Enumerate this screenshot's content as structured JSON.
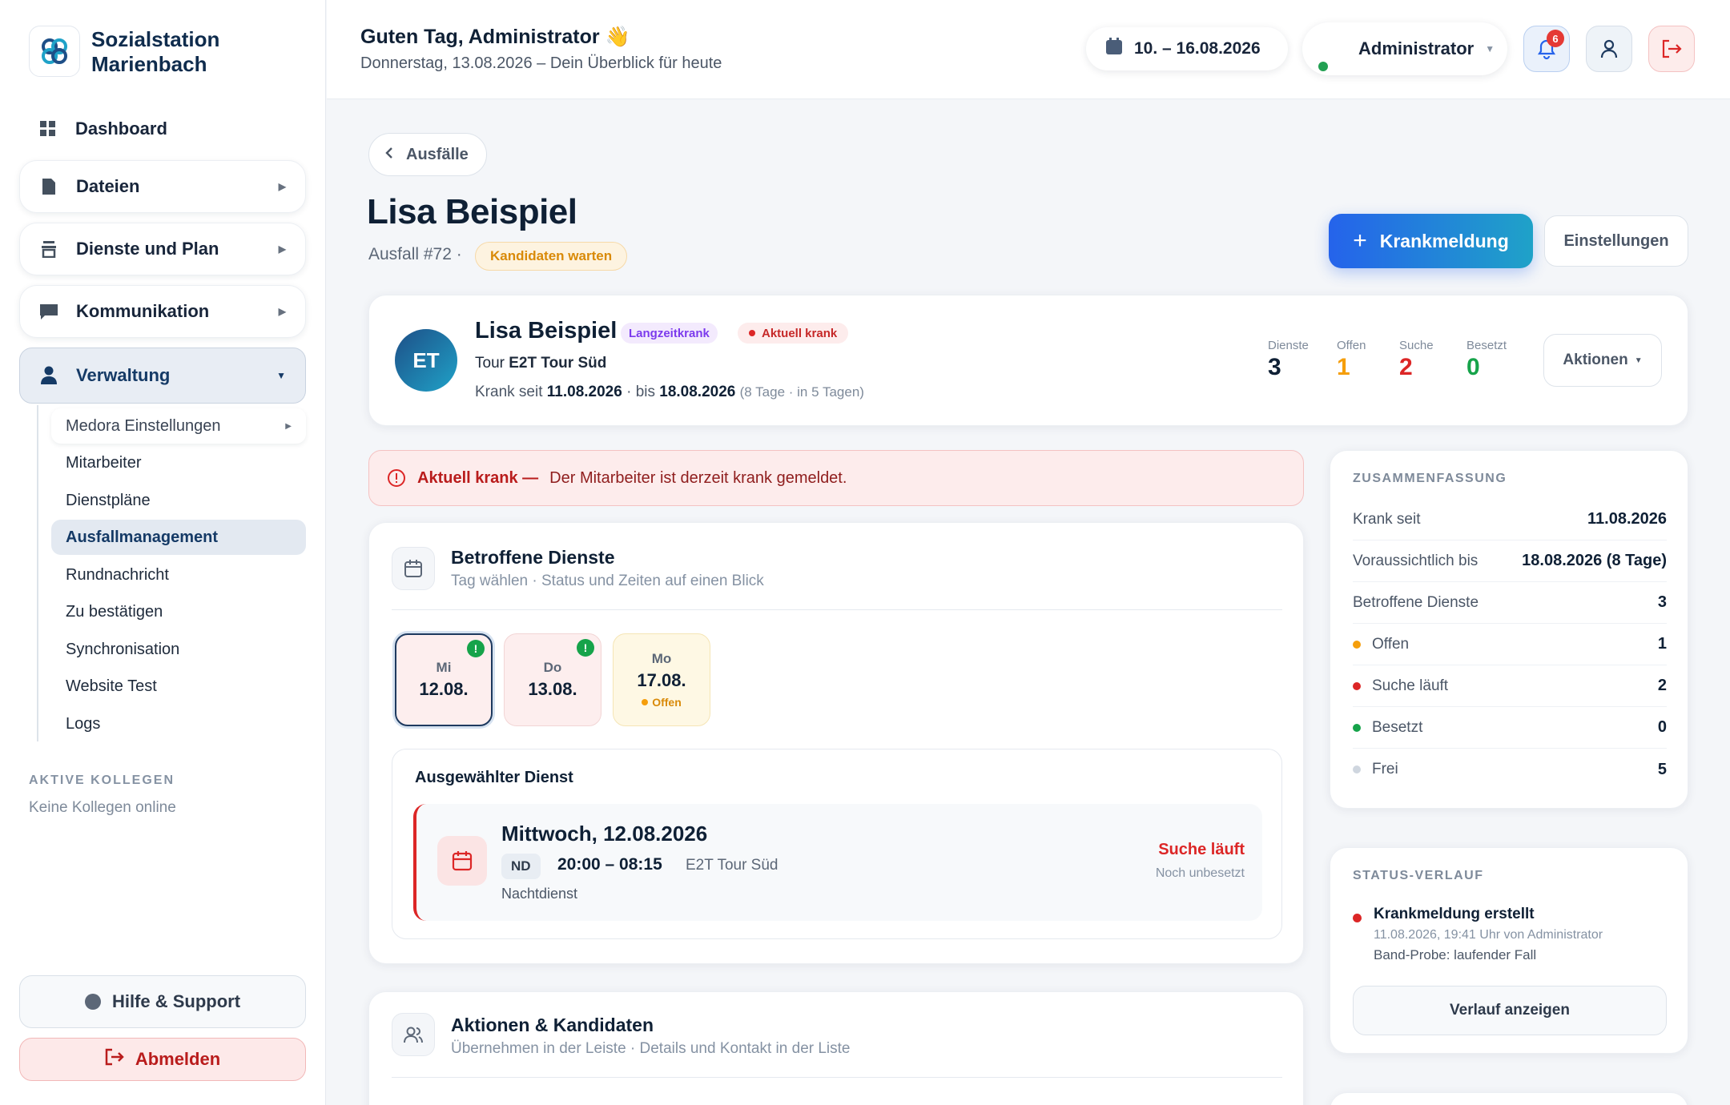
{
  "sidebar": {
    "brand_line1": "Sozialstation",
    "brand_line2": "Marienbach",
    "nav": [
      {
        "label": "Dashboard",
        "icon": "grid-icon"
      },
      {
        "label": "Dateien",
        "icon": "file-icon"
      },
      {
        "label": "Dienste und Plan",
        "icon": "stack-icon"
      },
      {
        "label": "Kommunikation",
        "icon": "chat-icon"
      },
      {
        "label": "Verwaltung",
        "icon": "user-icon"
      }
    ],
    "subnav": [
      "Medora Einstellungen",
      "Mitarbeiter",
      "Dienstpläne",
      "Ausfallmanagement",
      "Rundnachricht",
      "Zu bestätigen",
      "Synchronisation",
      "Website Test",
      "Logs"
    ],
    "active_heading": "AKTIVE KOLLEGEN",
    "active_note": "Keine Kollegen online",
    "help_label": "Hilfe & Support",
    "logout_label": "Abmelden"
  },
  "topbar": {
    "greeting": "Guten Tag, Administrator 👋",
    "subtitle": "Donnerstag, 13.08.2026 – Dein Überblick für heute",
    "date_range": "10. – 16.08.2026",
    "user_name": "Administrator",
    "notification_count": "6"
  },
  "page": {
    "back_label": "Ausfälle",
    "title": "Lisa Beispiel",
    "ausfall_id": "Ausfall #72 ·",
    "status": "Kandidaten warten",
    "primary_button": "Krankmeldung",
    "secondary_button": "Einstellungen"
  },
  "employee": {
    "initials": "ET",
    "name": "Lisa Beispiel",
    "tag_long": "Langzeitkrank",
    "tag_current": "Aktuell krank",
    "tour_prefix": "Tour ",
    "tour": "E2T Tour Süd",
    "krank_prefix": "Krank seit ",
    "krank_since": "11.08.2026",
    "krank_mid": " · bis ",
    "krank_until": "18.08.2026",
    "krank_note": "(8 Tage · in 5 Tagen)",
    "stats": [
      {
        "label": "Dienste",
        "value": "3",
        "color": "#0f2035"
      },
      {
        "label": "Offen",
        "value": "1",
        "color": "#f59e0b"
      },
      {
        "label": "Suche",
        "value": "2",
        "color": "#dc2626"
      },
      {
        "label": "Besetzt",
        "value": "0",
        "color": "#16a34a"
      }
    ],
    "actions_label": "Aktionen"
  },
  "alert": {
    "bold": "Aktuell krank —",
    "text": "Der Mitarbeiter ist derzeit krank gemeldet."
  },
  "shifts": {
    "title": "Betroffene Dienste",
    "subtitle": "Tag wählen · Status und Zeiten auf einen Blick",
    "days": [
      {
        "weekday": "Mi",
        "date": "12.08.",
        "status": ""
      },
      {
        "weekday": "Do",
        "date": "13.08.",
        "status": ""
      },
      {
        "weekday": "Mo",
        "date": "17.08.",
        "status": "Offen"
      }
    ],
    "selected_heading": "Ausgewählter Dienst",
    "selected": {
      "date": "Mittwoch, 12.08.2026",
      "code": "ND",
      "time": "20:00 – 08:15",
      "tour": "E2T Tour Süd",
      "type": "Nachtdienst",
      "status": "Suche läuft",
      "status_sub": "Noch unbesetzt"
    }
  },
  "candidates": {
    "title": "Aktionen & Kandidaten",
    "subtitle": "Übernehmen in der Leiste · Details und Kontakt in der Liste"
  },
  "summary": {
    "heading": "ZUSAMMENFASSUNG",
    "rows": [
      {
        "label": "Krank seit",
        "value": "11.08.2026",
        "dot": ""
      },
      {
        "label": "Voraussichtlich bis",
        "value": "18.08.2026 (8 Tage)",
        "dot": ""
      },
      {
        "label": "Betroffene Dienste",
        "value": "3",
        "dot": ""
      },
      {
        "label": "Offen",
        "value": "1",
        "dot": "#f59e0b"
      },
      {
        "label": "Suche läuft",
        "value": "2",
        "dot": "#dc2626"
      },
      {
        "label": "Besetzt",
        "value": "0",
        "dot": "#16a34a"
      },
      {
        "label": "Frei",
        "value": "5",
        "dot": "#cfd6df"
      }
    ]
  },
  "history": {
    "heading": "STATUS-VERLAUF",
    "entry_title": "Krankmeldung erstellt",
    "entry_meta": "11.08.2026, 19:41 Uhr von Administrator",
    "entry_note": "Band-Probe: laufender Fall",
    "button": "Verlauf anzeigen"
  }
}
